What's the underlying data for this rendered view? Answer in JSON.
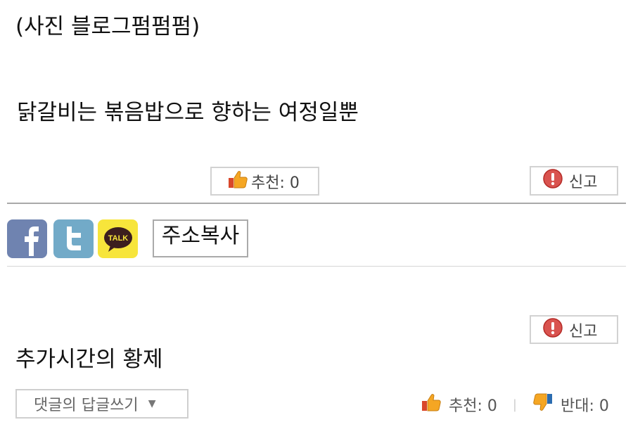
{
  "caption": "(사진 블로그펌펌펌)",
  "post_title": "닭갈비는 볶음밥으로 향하는 여정일뿐",
  "recommend_button": {
    "label": "추천: 0",
    "icon": "thumbs-up-icon"
  },
  "report_button": {
    "label": "신고",
    "icon": "warning-icon"
  },
  "share": {
    "facebook_icon": "facebook-icon",
    "twitter_icon": "twitter-icon",
    "kakaotalk_icon": "kakaotalk-icon",
    "kakaotalk_text": "TALK",
    "copy_label": "주소복사"
  },
  "comment": {
    "report_label": "신고",
    "text": "추가시간의 황제",
    "reply_dropdown_label": "댓글의 답글쓰기",
    "recommend_label": "추천: 0",
    "oppose_label": "반대: 0",
    "separator": "|"
  },
  "colors": {
    "facebook": "#6f83b0",
    "twitter": "#72aac8",
    "kakaotalk": "#f7e53b",
    "warning": "#d9534f",
    "thumb": "#f5a623"
  }
}
